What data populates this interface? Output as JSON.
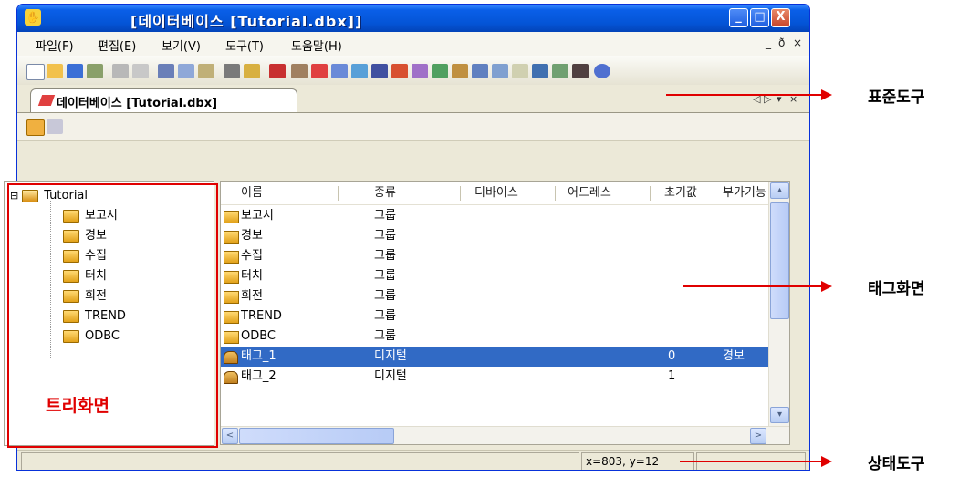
{
  "window": {
    "title": "[데이터베이스 [Tutorial.dbx]]",
    "min_label": "_",
    "max_label": "□",
    "close_label": "X"
  },
  "menubar": {
    "items": [
      "파일(F)",
      "편집(E)",
      "보기(V)",
      "도구(T)",
      "도움말(H)"
    ],
    "mdi_controls": [
      "_",
      "ð",
      "×"
    ]
  },
  "doc_tab": {
    "label": "데이터베이스 [Tutorial.dbx]",
    "controls": [
      "◁",
      "▷",
      "▾",
      "×"
    ]
  },
  "tree": {
    "root": "Tutorial",
    "expander": "⊟",
    "children": [
      "보고서",
      "경보",
      "수집",
      "터치",
      "회전",
      "TREND",
      "ODBC"
    ],
    "annotation": "트리화면"
  },
  "list": {
    "columns": [
      "이름",
      "종류",
      "디바이스",
      "어드레스",
      "초기값",
      "부가기능"
    ],
    "rows": [
      {
        "name": "보고서",
        "type": "그룹",
        "device": "",
        "address": "",
        "init": "",
        "extra": "",
        "icon": "folder"
      },
      {
        "name": "경보",
        "type": "그룹",
        "device": "",
        "address": "",
        "init": "",
        "extra": "",
        "icon": "folder"
      },
      {
        "name": "수집",
        "type": "그룹",
        "device": "",
        "address": "",
        "init": "",
        "extra": "",
        "icon": "folder"
      },
      {
        "name": "터치",
        "type": "그룹",
        "device": "",
        "address": "",
        "init": "",
        "extra": "",
        "icon": "folder"
      },
      {
        "name": "회전",
        "type": "그룹",
        "device": "",
        "address": "",
        "init": "",
        "extra": "",
        "icon": "folder"
      },
      {
        "name": "TREND",
        "type": "그룹",
        "device": "",
        "address": "",
        "init": "",
        "extra": "",
        "icon": "folder"
      },
      {
        "name": "ODBC",
        "type": "그룹",
        "device": "",
        "address": "",
        "init": "",
        "extra": "",
        "icon": "folder"
      },
      {
        "name": "태그_1",
        "type": "디지털",
        "device": "",
        "address": "",
        "init": "0",
        "extra": "경보",
        "icon": "tag",
        "selected": true
      },
      {
        "name": "태그_2",
        "type": "디지털",
        "device": "",
        "address": "",
        "init": "1",
        "extra": "",
        "icon": "tag"
      }
    ],
    "scroll_up": "▴",
    "scroll_down": "▾",
    "scroll_left": "<",
    "scroll_right": ">"
  },
  "status": {
    "coords": "x=803, y=12"
  },
  "annotations": {
    "toolbar": "표준도구",
    "tag_view": "태그화면",
    "statusbar": "상태도구"
  },
  "colors": {
    "title_blue": "#0454d6",
    "selection": "#316ac5",
    "annotation_red": "#e00000"
  }
}
